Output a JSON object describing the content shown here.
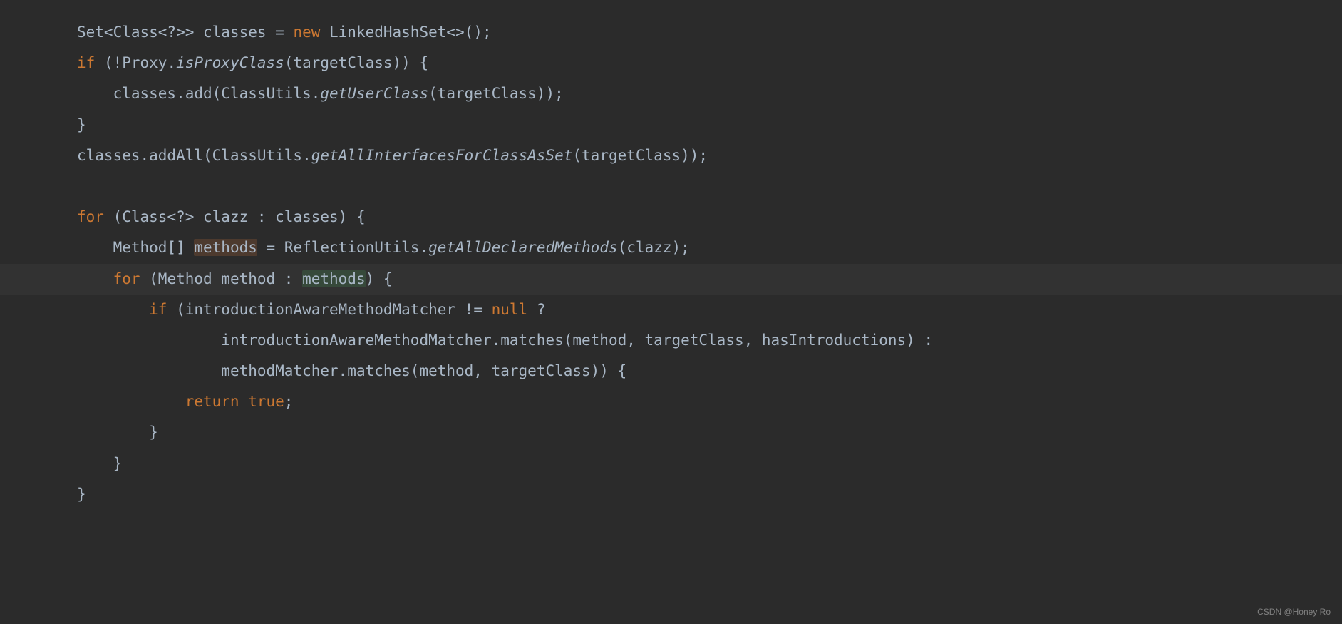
{
  "code": {
    "lines": [
      {
        "indent": 0,
        "tokens": [
          {
            "t": "txt",
            "v": "Set<Class<?>> classes = "
          },
          {
            "t": "kw",
            "v": "new"
          },
          {
            "t": "txt",
            "v": " LinkedHashSet<>();"
          }
        ]
      },
      {
        "indent": 0,
        "tokens": [
          {
            "t": "kw",
            "v": "if"
          },
          {
            "t": "txt",
            "v": " (!Proxy."
          },
          {
            "t": "italic",
            "v": "isProxyClass"
          },
          {
            "t": "txt",
            "v": "(targetClass)) {"
          }
        ]
      },
      {
        "indent": 1,
        "tokens": [
          {
            "t": "txt",
            "v": "classes.add(ClassUtils."
          },
          {
            "t": "italic",
            "v": "getUserClass"
          },
          {
            "t": "txt",
            "v": "(targetClass));"
          }
        ]
      },
      {
        "indent": 0,
        "tokens": [
          {
            "t": "txt",
            "v": "}"
          }
        ]
      },
      {
        "indent": 0,
        "tokens": [
          {
            "t": "txt",
            "v": "classes.addAll(ClassUtils."
          },
          {
            "t": "italic",
            "v": "getAllInterfacesForClassAsSet"
          },
          {
            "t": "txt",
            "v": "(targetClass));"
          }
        ]
      },
      {
        "indent": 0,
        "tokens": []
      },
      {
        "indent": 0,
        "tokens": [
          {
            "t": "kw",
            "v": "for"
          },
          {
            "t": "txt",
            "v": " (Class<?> clazz : classes) {"
          }
        ]
      },
      {
        "indent": 1,
        "tokens": [
          {
            "t": "txt",
            "v": "Method[] "
          },
          {
            "t": "hl-brown",
            "v": "methods"
          },
          {
            "t": "txt",
            "v": " = ReflectionUtils."
          },
          {
            "t": "italic",
            "v": "getAllDeclaredMethods"
          },
          {
            "t": "txt",
            "v": "(clazz);"
          }
        ]
      },
      {
        "indent": 1,
        "highlighted": true,
        "tokens": [
          {
            "t": "kw",
            "v": "for"
          },
          {
            "t": "txt",
            "v": " (Method method : "
          },
          {
            "t": "hl-green",
            "v": "methods"
          },
          {
            "t": "txt",
            "v": ") {"
          }
        ]
      },
      {
        "indent": 2,
        "tokens": [
          {
            "t": "kw",
            "v": "if"
          },
          {
            "t": "txt",
            "v": " (introductionAwareMethodMatcher != "
          },
          {
            "t": "kw",
            "v": "null"
          },
          {
            "t": "txt",
            "v": " ?"
          }
        ]
      },
      {
        "indent": 4,
        "tokens": [
          {
            "t": "txt",
            "v": "introductionAwareMethodMatcher.matches(method, targetClass, hasIntroductions) :"
          }
        ]
      },
      {
        "indent": 4,
        "tokens": [
          {
            "t": "txt",
            "v": "methodMatcher.matches(method, targetClass)) {"
          }
        ]
      },
      {
        "indent": 3,
        "tokens": [
          {
            "t": "kw",
            "v": "return true"
          },
          {
            "t": "txt",
            "v": ";"
          }
        ]
      },
      {
        "indent": 2,
        "tokens": [
          {
            "t": "txt",
            "v": "}"
          }
        ]
      },
      {
        "indent": 1,
        "tokens": [
          {
            "t": "txt",
            "v": "}"
          }
        ]
      },
      {
        "indent": 0,
        "tokens": [
          {
            "t": "txt",
            "v": "}"
          }
        ]
      }
    ]
  },
  "watermark": "CSDN @Honey Ro",
  "indent_unit": "    ",
  "colors": {
    "background": "#2b2b2b",
    "text": "#a9b7c6",
    "keyword": "#cc7832",
    "highlight_line": "#323232",
    "highlight_brown": "#4d3a2e",
    "highlight_green": "#36493a"
  }
}
